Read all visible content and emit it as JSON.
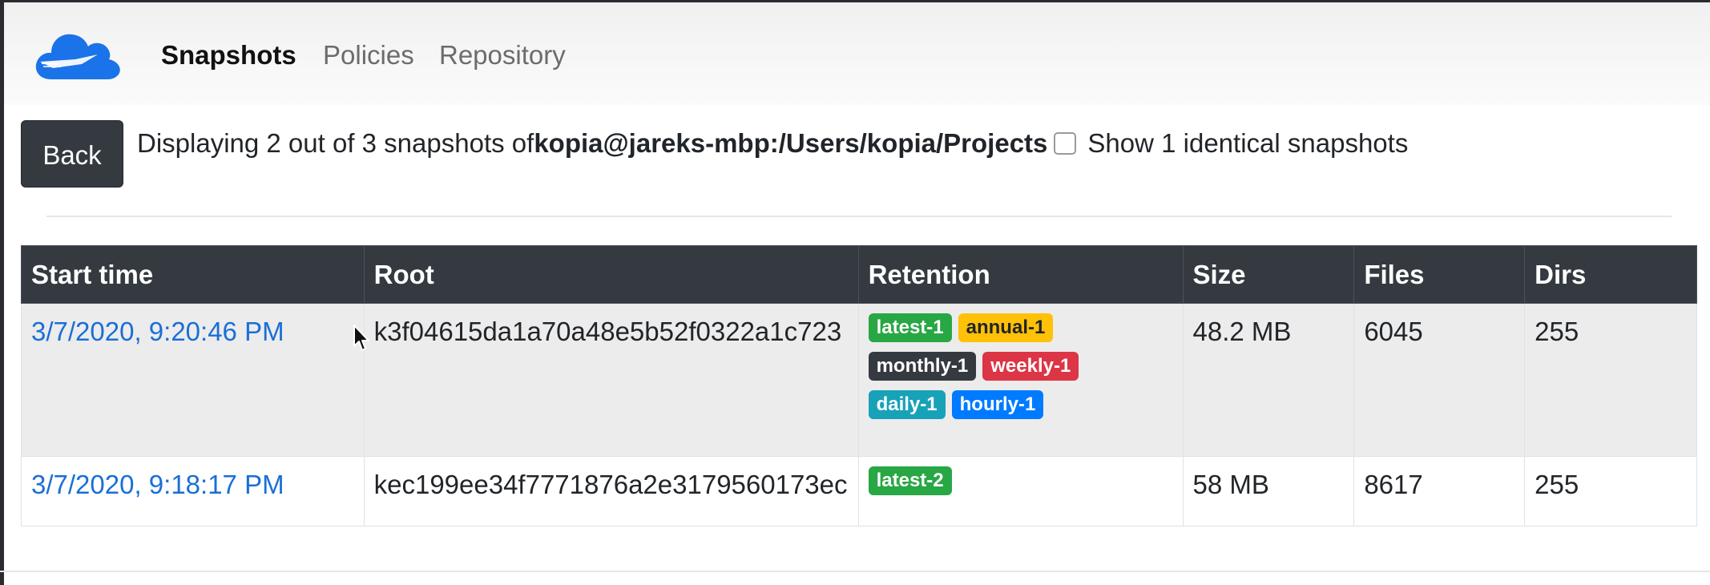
{
  "nav": {
    "items": [
      {
        "label": "Snapshots"
      },
      {
        "label": "Policies"
      },
      {
        "label": "Repository"
      }
    ]
  },
  "colors": {
    "brand_blue": "#1a73e8",
    "header_dark": "#343a40",
    "link": "#1a6fd6"
  },
  "toolbar": {
    "back_label": "Back",
    "summary_prefix": "Displaying 2 out of 3 snapshots of",
    "summary_source": "kopia@jareks-mbp:/Users/kopia/Projects",
    "identical_label": "Show 1 identical snapshots",
    "identical_checked": false
  },
  "table": {
    "headers": [
      "Start time",
      "Root",
      "Retention",
      "Size",
      "Files",
      "Dirs"
    ],
    "rows": [
      {
        "start_time": "3/7/2020, 9:20:46 PM",
        "root": "k3f04615da1a70a48e5b52f0322a1c723",
        "retention": [
          "latest-1",
          "annual-1",
          "monthly-1",
          "weekly-1",
          "daily-1",
          "hourly-1"
        ],
        "size": "48.2 MB",
        "files": "6045",
        "dirs": "255"
      },
      {
        "start_time": "3/7/2020, 9:18:17 PM",
        "root": "kec199ee34f7771876a2e3179560173ec",
        "retention": [
          "latest-2"
        ],
        "size": "58 MB",
        "files": "8617",
        "dirs": "255"
      }
    ]
  },
  "icons": {
    "logo": "kopia-cloud-logo",
    "cursor": "mouse-pointer-icon"
  }
}
